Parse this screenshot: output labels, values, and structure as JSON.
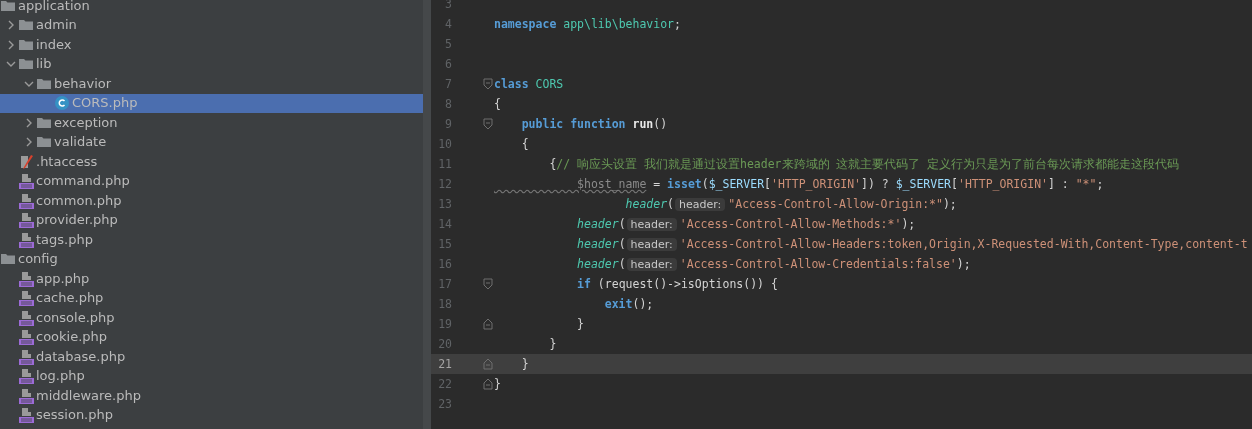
{
  "project_tree": [
    {
      "label": "application",
      "kind": "folder",
      "selected": false,
      "children": [
        {
          "label": "admin",
          "kind": "folder",
          "expanded": false,
          "selected": false
        },
        {
          "label": "index",
          "kind": "folder",
          "expanded": false,
          "selected": false
        },
        {
          "label": "lib",
          "kind": "folder",
          "expanded": true,
          "selected": false,
          "children": [
            {
              "label": "behavior",
              "kind": "folder",
              "expanded": true,
              "selected": false,
              "children": [
                {
                  "label": "CORS.php",
                  "kind": "class",
                  "selected": true
                }
              ]
            },
            {
              "label": "exception",
              "kind": "folder",
              "expanded": false,
              "selected": false
            },
            {
              "label": "validate",
              "kind": "folder",
              "expanded": false,
              "selected": false
            }
          ]
        },
        {
          "label": ".htaccess",
          "kind": "htaccess",
          "selected": false
        },
        {
          "label": "command.php",
          "kind": "php",
          "selected": false
        },
        {
          "label": "common.php",
          "kind": "php",
          "selected": false
        },
        {
          "label": "provider.php",
          "kind": "php",
          "selected": false
        },
        {
          "label": "tags.php",
          "kind": "php",
          "selected": false
        }
      ]
    },
    {
      "label": "config",
      "kind": "folder",
      "selected": false,
      "children": [
        {
          "label": "app.php",
          "kind": "php",
          "selected": false
        },
        {
          "label": "cache.php",
          "kind": "php",
          "selected": false
        },
        {
          "label": "console.php",
          "kind": "php",
          "selected": false
        },
        {
          "label": "cookie.php",
          "kind": "php",
          "selected": false
        },
        {
          "label": "database.php",
          "kind": "php",
          "selected": false
        },
        {
          "label": "log.php",
          "kind": "php",
          "selected": false
        },
        {
          "label": "middleware.php",
          "kind": "php",
          "selected": false
        },
        {
          "label": "session.php",
          "kind": "php",
          "selected": false
        }
      ]
    }
  ],
  "editor": {
    "lines": [
      {
        "number": "3",
        "current": false
      },
      {
        "number": "4",
        "current": false,
        "tokens": [
          {
            "text": "namespace ",
            "kind": "keyword"
          },
          {
            "text": "app\\lib\\behavior",
            "kind": "type"
          },
          {
            "text": ";",
            "kind": "punct"
          }
        ]
      },
      {
        "number": "5",
        "current": false
      },
      {
        "number": "6",
        "current": false
      },
      {
        "number": "7",
        "current": false,
        "fold_start": true,
        "tokens": [
          {
            "text": "class ",
            "kind": "keyword"
          },
          {
            "text": "CORS",
            "kind": "type"
          }
        ]
      },
      {
        "number": "8",
        "current": false,
        "tokens": [
          {
            "text": "{",
            "kind": "punct"
          }
        ]
      },
      {
        "number": "9",
        "current": false,
        "fold_start": true,
        "tokens": [
          {
            "text": "    public function ",
            "kind": "keyword"
          },
          {
            "text": "run",
            "kind": "function"
          },
          {
            "text": "()",
            "kind": "punct"
          }
        ]
      },
      {
        "number": "10",
        "current": false,
        "tokens": [
          {
            "text": "    {",
            "kind": "punct"
          }
        ]
      },
      {
        "number": "11",
        "current": false,
        "tokens": [
          {
            "text": "        {",
            "kind": "punct"
          },
          {
            "text": "// 响应头设置 我们就是通过设置header来跨域的 这就主要代码了 定义行为只是为了前台每次请求都能走这段代码",
            "kind": "comment"
          }
        ]
      },
      {
        "number": "12",
        "current": false,
        "tokens": [
          {
            "text": "            $host_name",
            "kind": "unused"
          },
          {
            "text": " = ",
            "kind": "punct"
          },
          {
            "text": "isset",
            "kind": "builtin"
          },
          {
            "text": "(",
            "kind": "punct"
          },
          {
            "text": "$_SERVER",
            "kind": "global"
          },
          {
            "text": "[",
            "kind": "punct"
          },
          {
            "text": "'HTTP_ORIGIN'",
            "kind": "string"
          },
          {
            "text": "]) ? ",
            "kind": "punct"
          },
          {
            "text": "$_SERVER",
            "kind": "global"
          },
          {
            "text": "[",
            "kind": "punct"
          },
          {
            "text": "'HTTP_ORIGIN'",
            "kind": "string"
          },
          {
            "text": "] : ",
            "kind": "punct"
          },
          {
            "text": "\"*\"",
            "kind": "string"
          },
          {
            "text": ";",
            "kind": "punct"
          }
        ]
      },
      {
        "number": "13",
        "current": false,
        "tokens": [
          {
            "text": "                   header",
            "kind": "call"
          },
          {
            "text": "(",
            "kind": "punct"
          },
          {
            "text": "header:",
            "kind": "hint"
          },
          {
            "text": "\"Access-Control-Allow-Origin:*\"",
            "kind": "string"
          },
          {
            "text": ");",
            "kind": "punct"
          }
        ]
      },
      {
        "number": "14",
        "current": false,
        "tokens": [
          {
            "text": "            header",
            "kind": "call"
          },
          {
            "text": "(",
            "kind": "punct"
          },
          {
            "text": "header:",
            "kind": "hint"
          },
          {
            "text": "'Access-Control-Allow-Methods:*'",
            "kind": "string"
          },
          {
            "text": ");",
            "kind": "punct"
          }
        ]
      },
      {
        "number": "15",
        "current": false,
        "tokens": [
          {
            "text": "            header",
            "kind": "call"
          },
          {
            "text": "(",
            "kind": "punct"
          },
          {
            "text": "header:",
            "kind": "hint"
          },
          {
            "text": "'Access-Control-Allow-Headers:token,Origin,X-Requested-With,Content-Type,content-t",
            "kind": "string"
          }
        ]
      },
      {
        "number": "16",
        "current": false,
        "tokens": [
          {
            "text": "            header",
            "kind": "call"
          },
          {
            "text": "(",
            "kind": "punct"
          },
          {
            "text": "header:",
            "kind": "hint"
          },
          {
            "text": "'Access-Control-Allow-Credentials:false'",
            "kind": "string"
          },
          {
            "text": ");",
            "kind": "punct"
          }
        ]
      },
      {
        "number": "17",
        "current": false,
        "fold_start": true,
        "tokens": [
          {
            "text": "            if ",
            "kind": "keyword"
          },
          {
            "text": "(request()->isOptions()) {",
            "kind": "punct"
          }
        ]
      },
      {
        "number": "18",
        "current": false,
        "tokens": [
          {
            "text": "                exit",
            "kind": "builtin"
          },
          {
            "text": "();",
            "kind": "punct"
          }
        ]
      },
      {
        "number": "19",
        "current": false,
        "fold_end": true,
        "tokens": [
          {
            "text": "            }",
            "kind": "punct"
          }
        ]
      },
      {
        "number": "20",
        "current": false,
        "tokens": [
          {
            "text": "        }",
            "kind": "punct"
          }
        ]
      },
      {
        "number": "21",
        "current": true,
        "fold_end": true,
        "tokens": [
          {
            "text": "    }",
            "kind": "punct"
          }
        ]
      },
      {
        "number": "22",
        "current": false,
        "fold_end": true,
        "tokens": [
          {
            "text": "}",
            "kind": "punct"
          }
        ]
      },
      {
        "number": "23",
        "current": false
      }
    ]
  }
}
